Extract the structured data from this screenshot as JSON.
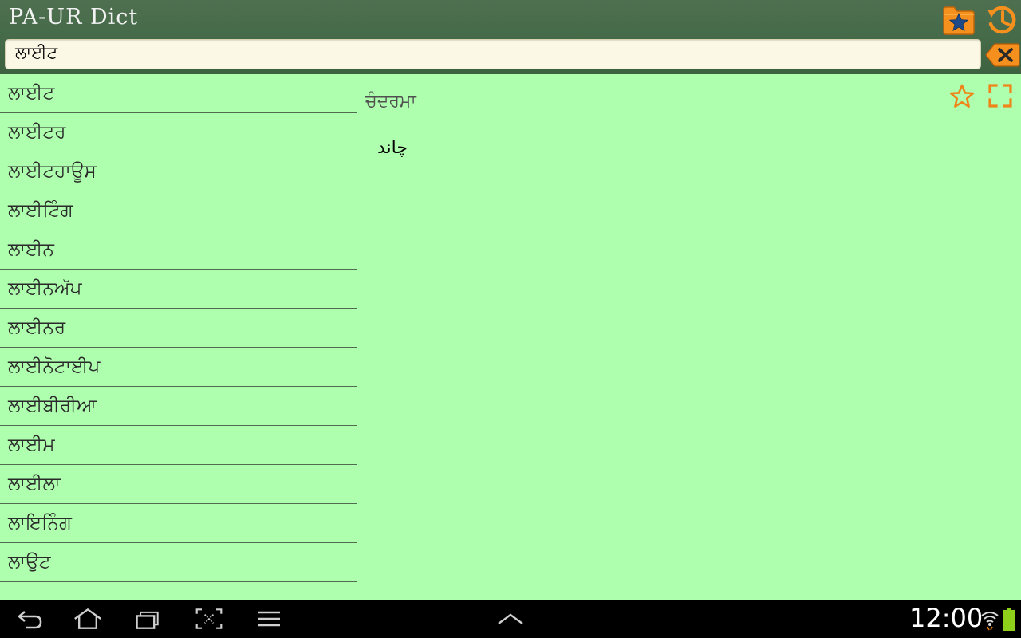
{
  "app": {
    "title": "PA-UR Dict"
  },
  "search": {
    "value": "ਲਾਈਟ"
  },
  "word_list": {
    "items": [
      "ਲਾਈਟ",
      "ਲਾਈਟਰ",
      "ਲਾਈਟਹਾਊਸ",
      "ਲਾਈਟਿੰਗ",
      "ਲਾਈਨ",
      "ਲਾਈਨਅੱਪ",
      "ਲਾਈਨਰ",
      "ਲਾਈਨੋਟਾਈਪ",
      "ਲਾਈਬੀਰੀਆ",
      "ਲਾਈਮ",
      "ਲਾਈਲਾ",
      "ਲਾਇਨਿੰਗ",
      "ਲਾਉਟ"
    ]
  },
  "detail": {
    "word": "ਚੰਦਰਮਾ",
    "translation": "چاند"
  },
  "icons": {
    "favorites_folder": "folder-star-icon",
    "history": "history-clock-icon",
    "clear": "clear-backspace-icon",
    "favorite": "star-outline-icon",
    "fullscreen": "fullscreen-icon"
  },
  "colors": {
    "header": "#446a48",
    "content_background": "#aeffae",
    "accent_orange": "#f08a1a"
  },
  "status_bar": {
    "time": "12:00"
  }
}
